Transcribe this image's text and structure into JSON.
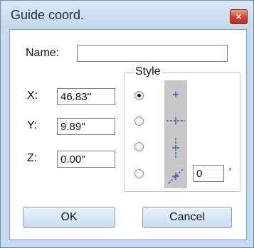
{
  "window": {
    "title": "Guide coord.",
    "close_glyph": "×"
  },
  "form": {
    "name_label": "Name:",
    "name_value": "",
    "x_label": "X:",
    "x_value": "46.83''",
    "y_label": "Y:",
    "y_value": "9.89''",
    "z_label": "Z:",
    "z_value": "0.00''"
  },
  "style_group": {
    "legend": "Style",
    "options": [
      {
        "icon": "point-icon",
        "selected": true
      },
      {
        "icon": "horizontal-guide-icon",
        "selected": false
      },
      {
        "icon": "vertical-guide-icon",
        "selected": false
      },
      {
        "icon": "angled-guide-icon",
        "selected": false
      }
    ],
    "angle_value": "0",
    "angle_unit": "°"
  },
  "buttons": {
    "ok_label": "OK",
    "cancel_label": "Cancel"
  },
  "colors": {
    "guide_blue": "#2a5db0",
    "title_bar": "#c3d7ed",
    "close_red": "#c7442d"
  }
}
